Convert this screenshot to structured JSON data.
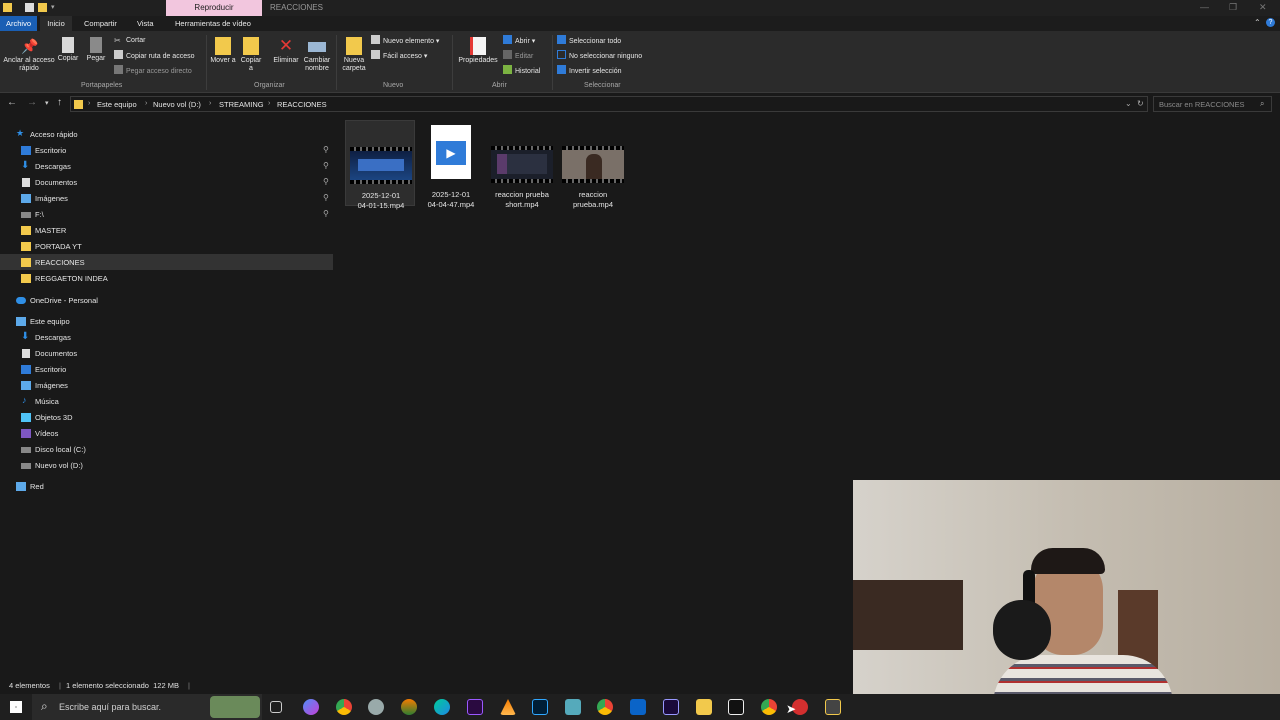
{
  "window": {
    "title": "REACCIONES",
    "context_tab": "Reproducir"
  },
  "ribbon_tabs": [
    "Archivo",
    "Inicio",
    "Compartir",
    "Vista",
    "Herramientas de vídeo"
  ],
  "ribbon": {
    "pin_quick_access": "Anclar al acceso rápido",
    "copy": "Copiar",
    "paste": "Pegar",
    "cut": "Cortar",
    "copy_path": "Copiar ruta de acceso",
    "paste_shortcut": "Pegar acceso directo",
    "group_clipboard": "Portapapeles",
    "move_to": "Mover a",
    "copy_to": "Copiar a",
    "delete": "Eliminar",
    "rename": "Cambiar nombre",
    "group_organize": "Organizar",
    "new_folder": "Nueva carpeta",
    "new_item": "Nuevo elemento",
    "easy_access": "Fácil acceso",
    "group_new": "Nuevo",
    "properties": "Propiedades",
    "open": "Abrir",
    "edit": "Editar",
    "history": "Historial",
    "group_open": "Abrir",
    "select_all": "Seleccionar todo",
    "select_none": "No seleccionar ninguno",
    "invert_selection": "Invertir selección",
    "group_select": "Seleccionar"
  },
  "address": {
    "crumbs": [
      "Este equipo",
      "Nuevo vol (D:)",
      "STREAMING",
      "REACCIONES"
    ],
    "search_placeholder": "Buscar en REACCIONES"
  },
  "nav": {
    "quick_access": "Acceso rápido",
    "quick_items": [
      "Escritorio",
      "Descargas",
      "Documentos",
      "Imágenes",
      "F:\\",
      "MASTER",
      "PORTADA YT",
      "REACCIONES",
      "REGGAETON INDEA"
    ],
    "onedrive": "OneDrive - Personal",
    "this_pc": "Este equipo",
    "pc_items": [
      "Descargas",
      "Documentos",
      "Escritorio",
      "Imágenes",
      "Música",
      "Objetos 3D",
      "Vídeos",
      "Disco local (C:)",
      "Nuevo vol (D:)"
    ],
    "network": "Red"
  },
  "files": [
    {
      "line1": "2025-12-01",
      "line2": "04-01-15.mp4"
    },
    {
      "line1": "2025-12-01",
      "line2": "04-04-47.mp4"
    },
    {
      "line1": "reaccion prueba",
      "line2": "short.mp4"
    },
    {
      "line1": "reaccion",
      "line2": "prueba.mp4"
    }
  ],
  "status": {
    "count": "4 elementos",
    "selection": "1 elemento seleccionado  122 MB"
  },
  "taskbar": {
    "search_placeholder": "Escribe aquí para buscar."
  },
  "colors": {
    "accent": "#1a5fb4",
    "context_tab": "#f2c6de",
    "background": "#191919"
  }
}
